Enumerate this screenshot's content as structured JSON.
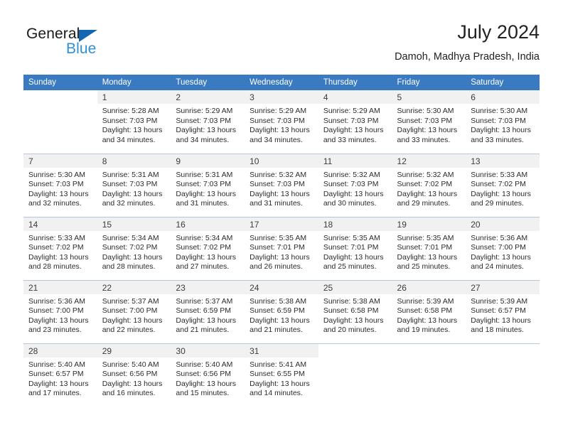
{
  "logo": {
    "word_top": "General",
    "word_bottom": "Blue",
    "triangle_color": "#1267b2",
    "blue_color": "#2e8fd6"
  },
  "header": {
    "title": "July 2024",
    "subtitle": "Damoh, Madhya Pradesh, India"
  },
  "theme": {
    "header_blue": "#3a7ac0",
    "daynum_band": "#f1f1f1",
    "grid_line": "#b9c6d6"
  },
  "weekdays": [
    "Sunday",
    "Monday",
    "Tuesday",
    "Wednesday",
    "Thursday",
    "Friday",
    "Saturday"
  ],
  "weeks": [
    [
      {
        "day": "",
        "sunrise": "",
        "sunset": "",
        "daylight_line1": "",
        "daylight_line2": ""
      },
      {
        "day": "1",
        "sunrise": "Sunrise: 5:28 AM",
        "sunset": "Sunset: 7:03 PM",
        "daylight_line1": "Daylight: 13 hours",
        "daylight_line2": "and 34 minutes."
      },
      {
        "day": "2",
        "sunrise": "Sunrise: 5:29 AM",
        "sunset": "Sunset: 7:03 PM",
        "daylight_line1": "Daylight: 13 hours",
        "daylight_line2": "and 34 minutes."
      },
      {
        "day": "3",
        "sunrise": "Sunrise: 5:29 AM",
        "sunset": "Sunset: 7:03 PM",
        "daylight_line1": "Daylight: 13 hours",
        "daylight_line2": "and 34 minutes."
      },
      {
        "day": "4",
        "sunrise": "Sunrise: 5:29 AM",
        "sunset": "Sunset: 7:03 PM",
        "daylight_line1": "Daylight: 13 hours",
        "daylight_line2": "and 33 minutes."
      },
      {
        "day": "5",
        "sunrise": "Sunrise: 5:30 AM",
        "sunset": "Sunset: 7:03 PM",
        "daylight_line1": "Daylight: 13 hours",
        "daylight_line2": "and 33 minutes."
      },
      {
        "day": "6",
        "sunrise": "Sunrise: 5:30 AM",
        "sunset": "Sunset: 7:03 PM",
        "daylight_line1": "Daylight: 13 hours",
        "daylight_line2": "and 33 minutes."
      }
    ],
    [
      {
        "day": "7",
        "sunrise": "Sunrise: 5:30 AM",
        "sunset": "Sunset: 7:03 PM",
        "daylight_line1": "Daylight: 13 hours",
        "daylight_line2": "and 32 minutes."
      },
      {
        "day": "8",
        "sunrise": "Sunrise: 5:31 AM",
        "sunset": "Sunset: 7:03 PM",
        "daylight_line1": "Daylight: 13 hours",
        "daylight_line2": "and 32 minutes."
      },
      {
        "day": "9",
        "sunrise": "Sunrise: 5:31 AM",
        "sunset": "Sunset: 7:03 PM",
        "daylight_line1": "Daylight: 13 hours",
        "daylight_line2": "and 31 minutes."
      },
      {
        "day": "10",
        "sunrise": "Sunrise: 5:32 AM",
        "sunset": "Sunset: 7:03 PM",
        "daylight_line1": "Daylight: 13 hours",
        "daylight_line2": "and 31 minutes."
      },
      {
        "day": "11",
        "sunrise": "Sunrise: 5:32 AM",
        "sunset": "Sunset: 7:03 PM",
        "daylight_line1": "Daylight: 13 hours",
        "daylight_line2": "and 30 minutes."
      },
      {
        "day": "12",
        "sunrise": "Sunrise: 5:32 AM",
        "sunset": "Sunset: 7:02 PM",
        "daylight_line1": "Daylight: 13 hours",
        "daylight_line2": "and 29 minutes."
      },
      {
        "day": "13",
        "sunrise": "Sunrise: 5:33 AM",
        "sunset": "Sunset: 7:02 PM",
        "daylight_line1": "Daylight: 13 hours",
        "daylight_line2": "and 29 minutes."
      }
    ],
    [
      {
        "day": "14",
        "sunrise": "Sunrise: 5:33 AM",
        "sunset": "Sunset: 7:02 PM",
        "daylight_line1": "Daylight: 13 hours",
        "daylight_line2": "and 28 minutes."
      },
      {
        "day": "15",
        "sunrise": "Sunrise: 5:34 AM",
        "sunset": "Sunset: 7:02 PM",
        "daylight_line1": "Daylight: 13 hours",
        "daylight_line2": "and 28 minutes."
      },
      {
        "day": "16",
        "sunrise": "Sunrise: 5:34 AM",
        "sunset": "Sunset: 7:02 PM",
        "daylight_line1": "Daylight: 13 hours",
        "daylight_line2": "and 27 minutes."
      },
      {
        "day": "17",
        "sunrise": "Sunrise: 5:35 AM",
        "sunset": "Sunset: 7:01 PM",
        "daylight_line1": "Daylight: 13 hours",
        "daylight_line2": "and 26 minutes."
      },
      {
        "day": "18",
        "sunrise": "Sunrise: 5:35 AM",
        "sunset": "Sunset: 7:01 PM",
        "daylight_line1": "Daylight: 13 hours",
        "daylight_line2": "and 25 minutes."
      },
      {
        "day": "19",
        "sunrise": "Sunrise: 5:35 AM",
        "sunset": "Sunset: 7:01 PM",
        "daylight_line1": "Daylight: 13 hours",
        "daylight_line2": "and 25 minutes."
      },
      {
        "day": "20",
        "sunrise": "Sunrise: 5:36 AM",
        "sunset": "Sunset: 7:00 PM",
        "daylight_line1": "Daylight: 13 hours",
        "daylight_line2": "and 24 minutes."
      }
    ],
    [
      {
        "day": "21",
        "sunrise": "Sunrise: 5:36 AM",
        "sunset": "Sunset: 7:00 PM",
        "daylight_line1": "Daylight: 13 hours",
        "daylight_line2": "and 23 minutes."
      },
      {
        "day": "22",
        "sunrise": "Sunrise: 5:37 AM",
        "sunset": "Sunset: 7:00 PM",
        "daylight_line1": "Daylight: 13 hours",
        "daylight_line2": "and 22 minutes."
      },
      {
        "day": "23",
        "sunrise": "Sunrise: 5:37 AM",
        "sunset": "Sunset: 6:59 PM",
        "daylight_line1": "Daylight: 13 hours",
        "daylight_line2": "and 21 minutes."
      },
      {
        "day": "24",
        "sunrise": "Sunrise: 5:38 AM",
        "sunset": "Sunset: 6:59 PM",
        "daylight_line1": "Daylight: 13 hours",
        "daylight_line2": "and 21 minutes."
      },
      {
        "day": "25",
        "sunrise": "Sunrise: 5:38 AM",
        "sunset": "Sunset: 6:58 PM",
        "daylight_line1": "Daylight: 13 hours",
        "daylight_line2": "and 20 minutes."
      },
      {
        "day": "26",
        "sunrise": "Sunrise: 5:39 AM",
        "sunset": "Sunset: 6:58 PM",
        "daylight_line1": "Daylight: 13 hours",
        "daylight_line2": "and 19 minutes."
      },
      {
        "day": "27",
        "sunrise": "Sunrise: 5:39 AM",
        "sunset": "Sunset: 6:57 PM",
        "daylight_line1": "Daylight: 13 hours",
        "daylight_line2": "and 18 minutes."
      }
    ],
    [
      {
        "day": "28",
        "sunrise": "Sunrise: 5:40 AM",
        "sunset": "Sunset: 6:57 PM",
        "daylight_line1": "Daylight: 13 hours",
        "daylight_line2": "and 17 minutes."
      },
      {
        "day": "29",
        "sunrise": "Sunrise: 5:40 AM",
        "sunset": "Sunset: 6:56 PM",
        "daylight_line1": "Daylight: 13 hours",
        "daylight_line2": "and 16 minutes."
      },
      {
        "day": "30",
        "sunrise": "Sunrise: 5:40 AM",
        "sunset": "Sunset: 6:56 PM",
        "daylight_line1": "Daylight: 13 hours",
        "daylight_line2": "and 15 minutes."
      },
      {
        "day": "31",
        "sunrise": "Sunrise: 5:41 AM",
        "sunset": "Sunset: 6:55 PM",
        "daylight_line1": "Daylight: 13 hours",
        "daylight_line2": "and 14 minutes."
      },
      {
        "day": "",
        "sunrise": "",
        "sunset": "",
        "daylight_line1": "",
        "daylight_line2": ""
      },
      {
        "day": "",
        "sunrise": "",
        "sunset": "",
        "daylight_line1": "",
        "daylight_line2": ""
      },
      {
        "day": "",
        "sunrise": "",
        "sunset": "",
        "daylight_line1": "",
        "daylight_line2": ""
      }
    ]
  ]
}
